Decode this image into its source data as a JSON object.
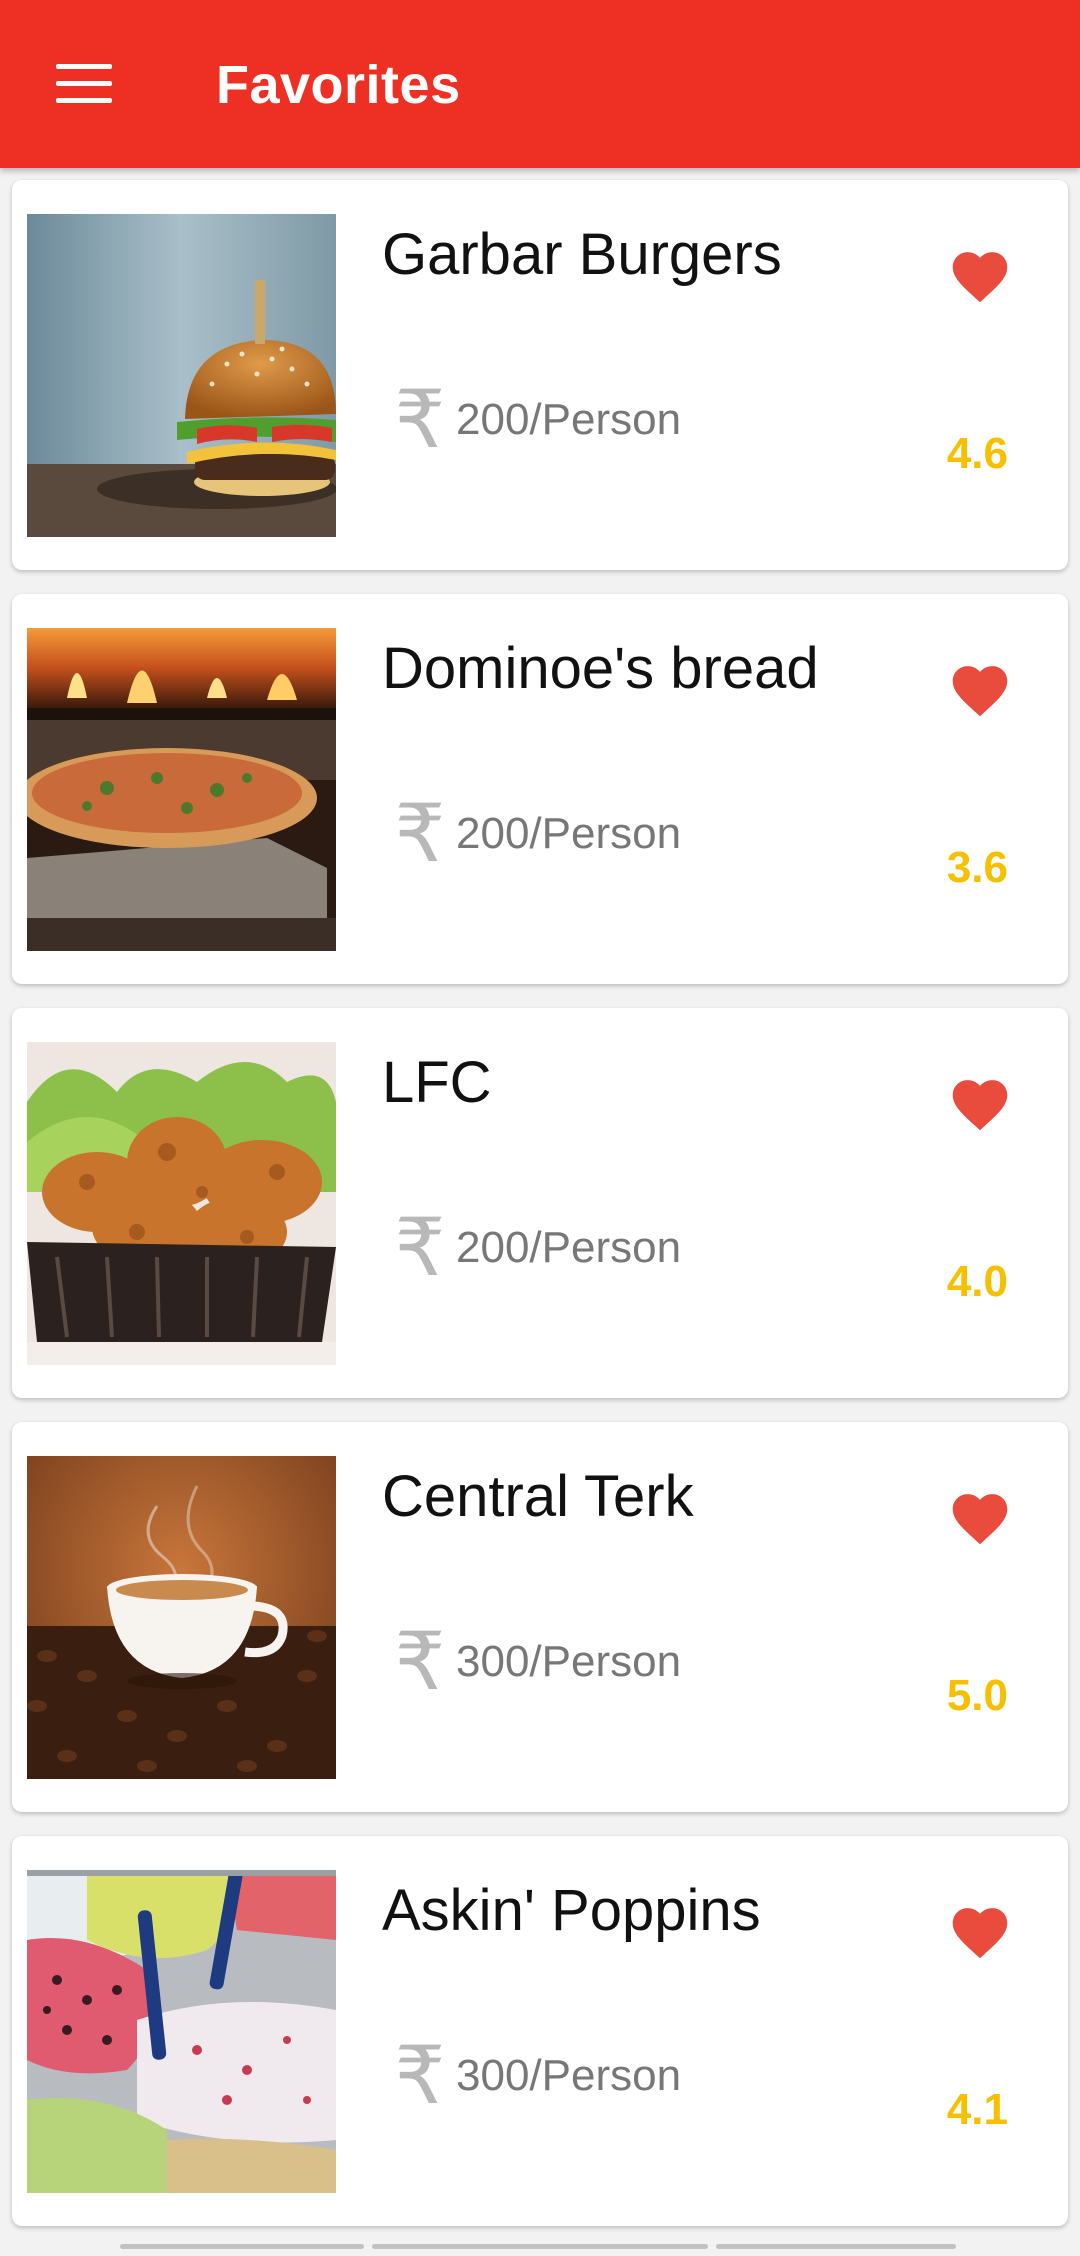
{
  "appbar": {
    "title": "Favorites",
    "menu_icon": "hamburger-menu-icon",
    "color": "#ee3024"
  },
  "colors": {
    "heart": "#e94b3c",
    "rating": "#f6c000",
    "price": "#777777"
  },
  "restaurants": [
    {
      "name": "Garbar Burgers",
      "price": "200/Person",
      "rating": "4.6",
      "image": "burger-photo",
      "favorite": true
    },
    {
      "name": "Dominoe's bread",
      "price": "200/Person",
      "rating": "3.6",
      "image": "pizza-photo",
      "favorite": true
    },
    {
      "name": "LFC",
      "price": "200/Person",
      "rating": "4.0",
      "image": "fried-chicken-photo",
      "favorite": true
    },
    {
      "name": "Central Terk",
      "price": "300/Person",
      "rating": "5.0",
      "image": "coffee-cup-photo",
      "favorite": true
    },
    {
      "name": "Askin' Poppins",
      "price": "300/Person",
      "rating": "4.1",
      "image": "ice-cream-photo",
      "favorite": true
    }
  ]
}
